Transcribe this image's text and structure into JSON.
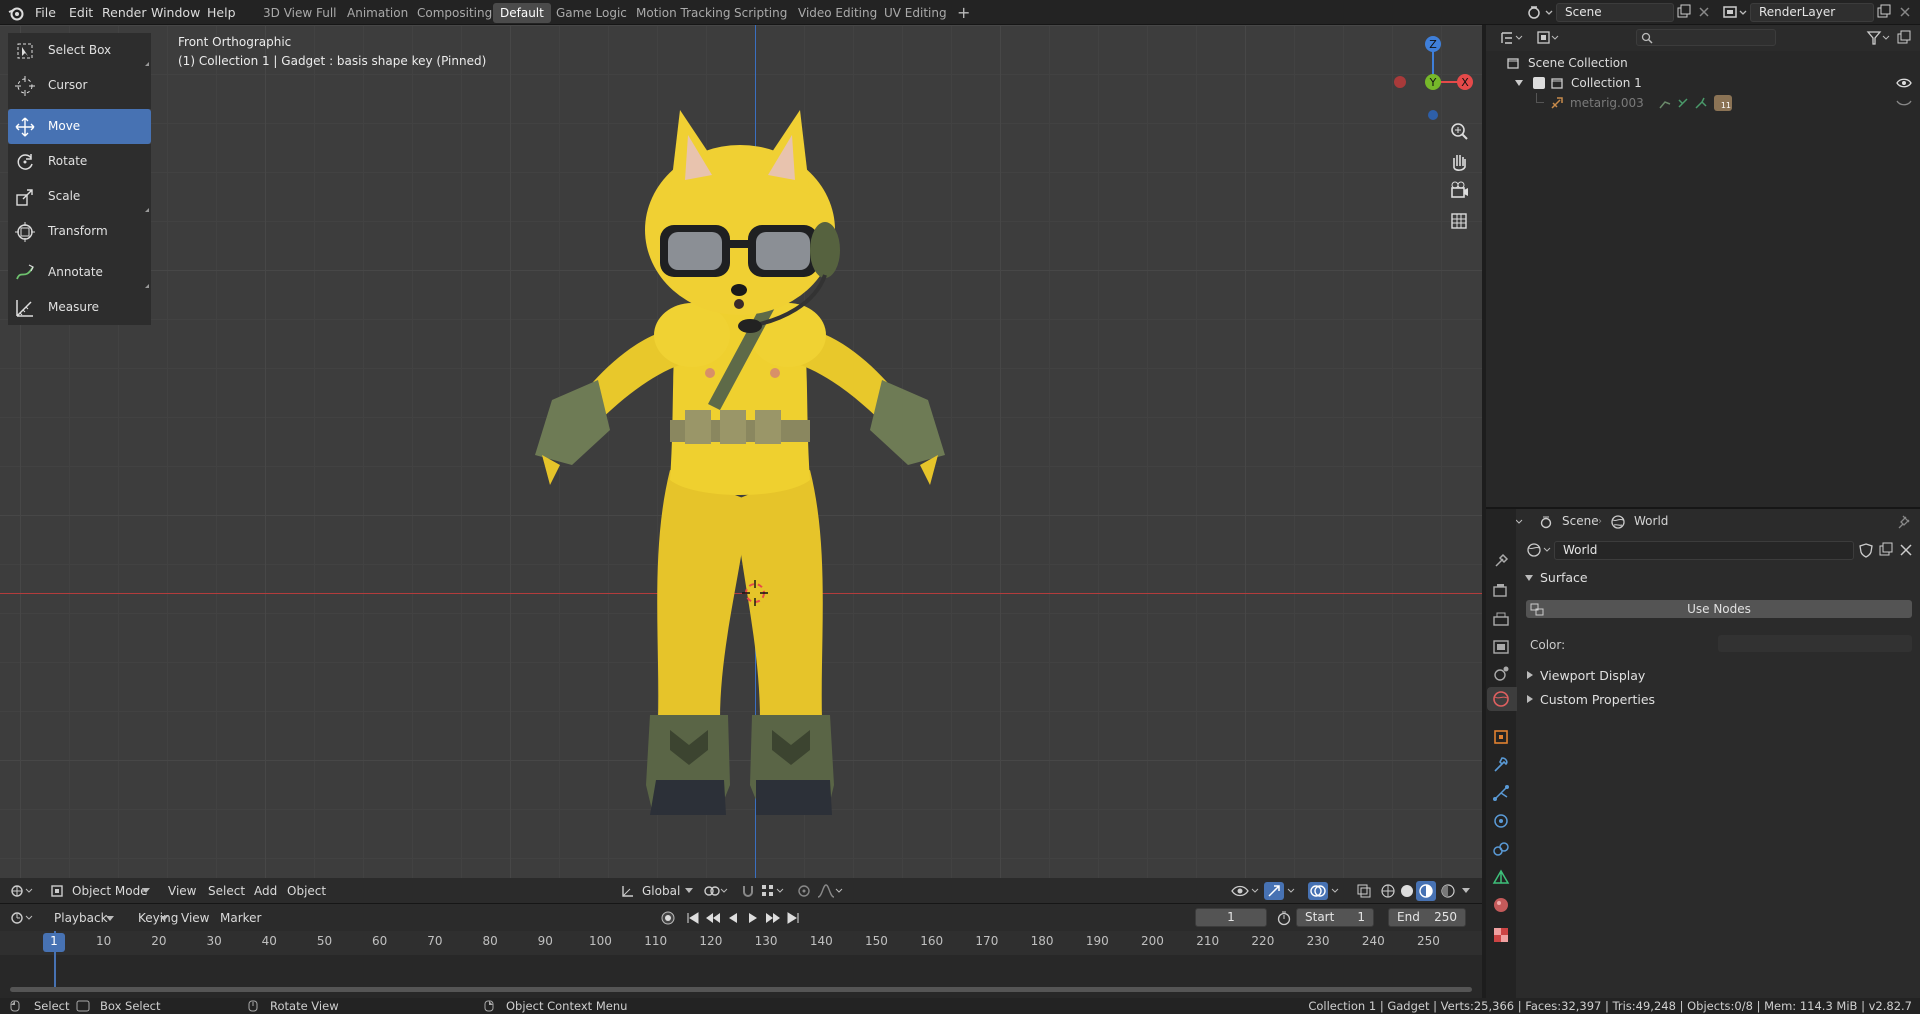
{
  "app": {
    "logo_icon": "blender-logo-icon"
  },
  "menu": [
    "File",
    "Edit",
    "Render",
    "Window",
    "Help"
  ],
  "workspaces": [
    {
      "label": "3D View Full",
      "active": false
    },
    {
      "label": "Animation",
      "active": false
    },
    {
      "label": "Compositing",
      "active": false
    },
    {
      "label": "Default",
      "active": true
    },
    {
      "label": "Game Logic",
      "active": false
    },
    {
      "label": "Motion Tracking",
      "active": false
    },
    {
      "label": "Scripting",
      "active": false
    },
    {
      "label": "Video Editing",
      "active": false
    },
    {
      "label": "UV Editing",
      "active": false
    }
  ],
  "scene_field": "Scene",
  "render_layer_field": "RenderLayer",
  "viewport": {
    "view_name": "Front Orthographic",
    "object_info": "(1) Collection 1 | Gadget : basis shape key (Pinned)",
    "gizmo": {
      "z": "Z",
      "y": "Y",
      "x": "X"
    },
    "colors": {
      "x_axis": "#e64a4a",
      "y_axis": "#76b82a",
      "z_axis": "#3f7fd9",
      "active_tool": "#4772b3"
    }
  },
  "tools": [
    {
      "label": "Select Box",
      "icon": "select-box-icon",
      "active": false,
      "corner": true
    },
    {
      "label": "Cursor",
      "icon": "cursor-icon",
      "active": false,
      "corner": false
    },
    {
      "label": "Move",
      "icon": "move-icon",
      "active": true,
      "corner": false
    },
    {
      "label": "Rotate",
      "icon": "rotate-icon",
      "active": false,
      "corner": false
    },
    {
      "label": "Scale",
      "icon": "scale-icon",
      "active": false,
      "corner": true
    },
    {
      "label": "Transform",
      "icon": "transform-icon",
      "active": false,
      "corner": false
    },
    {
      "label": "Annotate",
      "icon": "annotate-icon",
      "active": false,
      "corner": true
    },
    {
      "label": "Measure",
      "icon": "measure-icon",
      "active": false,
      "corner": false
    }
  ],
  "viewport_header": {
    "mode": "Object Mode",
    "menus": [
      "View",
      "Select",
      "Add",
      "Object"
    ],
    "orientation": "Global"
  },
  "timeline": {
    "menus": [
      "Playback",
      "Keying",
      "View",
      "Marker"
    ],
    "current_frame": "1",
    "start_label": "Start",
    "start": "1",
    "end_label": "End",
    "end": "250",
    "ruler": [
      "1",
      "10",
      "20",
      "30",
      "40",
      "50",
      "60",
      "70",
      "80",
      "90",
      "100",
      "110",
      "120",
      "130",
      "140",
      "150",
      "160",
      "170",
      "180",
      "190",
      "200",
      "210",
      "220",
      "230",
      "240",
      "250"
    ]
  },
  "outliner": {
    "scene_collection": "Scene Collection",
    "collection": "Collection 1",
    "object": "metarig.003",
    "object_badge": "11"
  },
  "properties": {
    "context_scene": "Scene",
    "context_world": "World",
    "world_field": "World",
    "surface_label": "Surface",
    "use_nodes_label": "Use Nodes",
    "color_label": "Color:",
    "viewport_display_label": "Viewport Display",
    "custom_properties_label": "Custom Properties"
  },
  "status": {
    "select": "Select",
    "box_select": "Box Select",
    "rotate_view": "Rotate View",
    "context_menu": "Object Context Menu",
    "stats": "Collection 1 | Gadget | Verts:25,366 | Faces:32,397 | Tris:49,248 | Objects:0/8 | Mem: 114.3 MiB | v2.82.7"
  }
}
